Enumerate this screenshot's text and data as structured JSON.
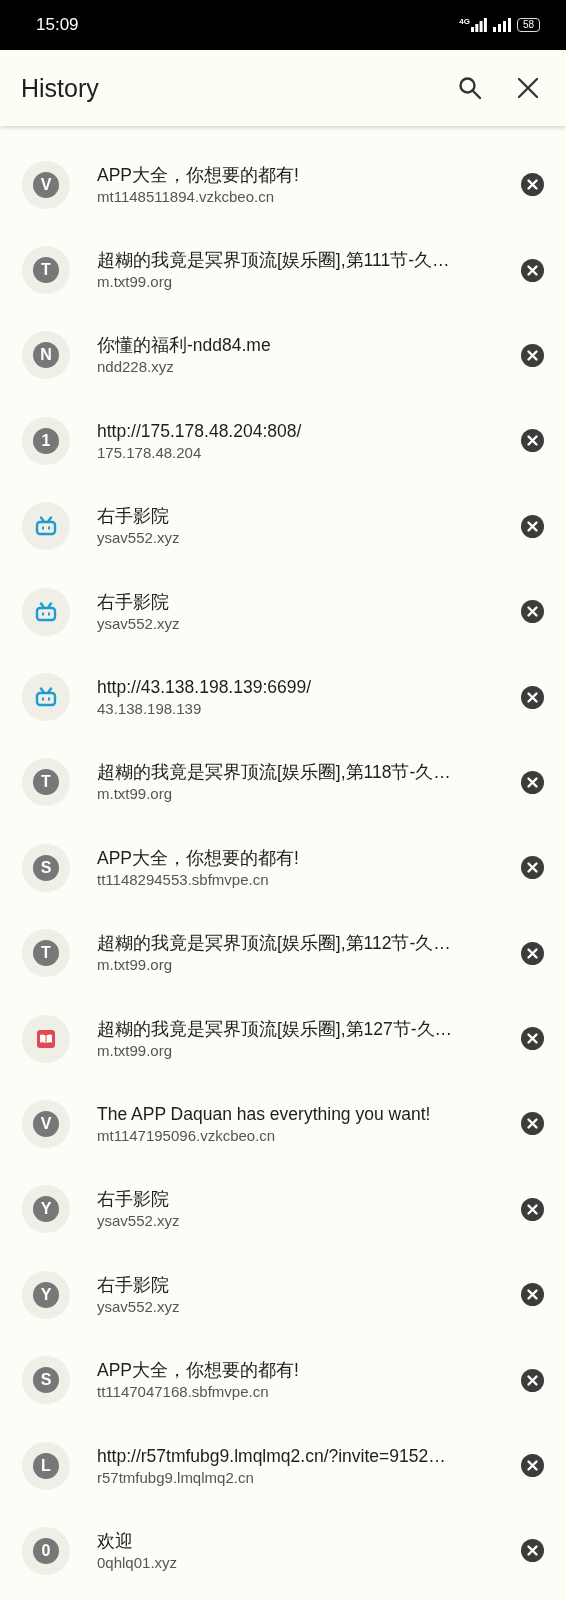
{
  "status_bar": {
    "time": "15:09",
    "network": "4G",
    "battery": "58"
  },
  "header": {
    "title": "History"
  },
  "items": [
    {
      "kind": "letter",
      "letter": "V",
      "title": "APP大全，你想要的都有!",
      "url": "mt1148511894.vzkcbeo.cn"
    },
    {
      "kind": "letter",
      "letter": "T",
      "title": "超糊的我竟是冥界顶流[娱乐圈],第111节-久…",
      "url": "m.txt99.org"
    },
    {
      "kind": "letter",
      "letter": "N",
      "title": "你懂的福利-ndd84.me",
      "url": "ndd228.xyz"
    },
    {
      "kind": "letter",
      "letter": "1",
      "title": "http://175.178.48.204:808/",
      "url": "175.178.48.204"
    },
    {
      "kind": "tv",
      "title": "右手影院",
      "url": "ysav552.xyz"
    },
    {
      "kind": "tv",
      "title": "右手影院",
      "url": "ysav552.xyz"
    },
    {
      "kind": "tv",
      "title": "http://43.138.198.139:6699/",
      "url": "43.138.198.139"
    },
    {
      "kind": "letter",
      "letter": "T",
      "title": "超糊的我竟是冥界顶流[娱乐圈],第118节-久…",
      "url": "m.txt99.org"
    },
    {
      "kind": "letter",
      "letter": "S",
      "title": "APP大全，你想要的都有!",
      "url": "tt1148294553.sbfmvpe.cn"
    },
    {
      "kind": "letter",
      "letter": "T",
      "title": "超糊的我竟是冥界顶流[娱乐圈],第112节-久…",
      "url": "m.txt99.org"
    },
    {
      "kind": "book",
      "title": "超糊的我竟是冥界顶流[娱乐圈],第127节-久…",
      "url": "m.txt99.org"
    },
    {
      "kind": "letter",
      "letter": "V",
      "title": "The APP Daquan has everything you want!",
      "url": "mt1147195096.vzkcbeo.cn"
    },
    {
      "kind": "letter",
      "letter": "Y",
      "title": "右手影院",
      "url": "ysav552.xyz"
    },
    {
      "kind": "letter",
      "letter": "Y",
      "title": "右手影院",
      "url": "ysav552.xyz"
    },
    {
      "kind": "letter",
      "letter": "S",
      "title": "APP大全，你想要的都有!",
      "url": "tt1147047168.sbfmvpe.cn"
    },
    {
      "kind": "letter",
      "letter": "L",
      "title": "http://r57tmfubg9.lmqlmq2.cn/?invite=9152…",
      "url": "r57tmfubg9.lmqlmq2.cn"
    },
    {
      "kind": "letter",
      "letter": "0",
      "title": "欢迎",
      "url": "0qhlq01.xyz"
    }
  ]
}
